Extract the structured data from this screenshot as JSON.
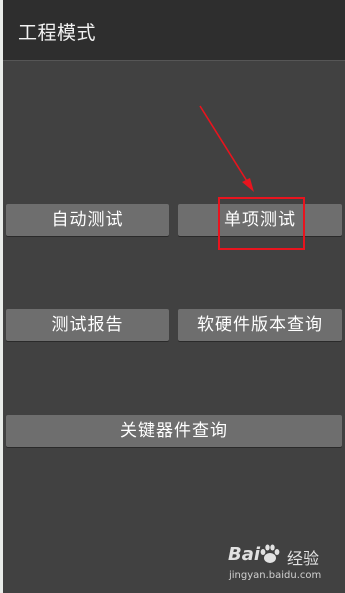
{
  "app": {
    "title": "工程模式"
  },
  "buttons": {
    "auto_test": "自动测试",
    "single_test": "单项测试",
    "test_report": "测试报告",
    "hw_sw_version": "软硬件版本查询",
    "key_device_query": "关键器件查询"
  },
  "annotation": {
    "highlight_color": "#e8141e",
    "arrow_color": "#e8141e"
  },
  "watermark": {
    "brand": "Bai",
    "product": "经验",
    "url": "jingyan.baidu.com"
  },
  "colors": {
    "background": "#414141",
    "titlebar": "#2e2e2e",
    "button": "#6e6e6e",
    "text": "#ffffff"
  }
}
